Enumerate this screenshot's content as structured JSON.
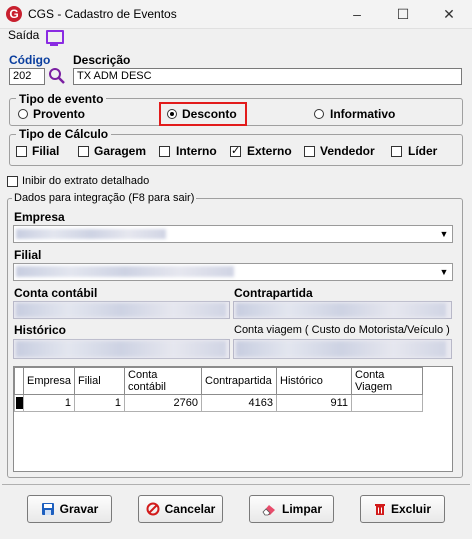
{
  "window": {
    "title": "CGS - Cadastro de Eventos",
    "minimize": "–",
    "maximize": "☐",
    "close": "✕"
  },
  "menu": {
    "saida": "Saída"
  },
  "codigo": {
    "label": "Código",
    "value": "202"
  },
  "descricao": {
    "label": "Descrição",
    "value": "TX ADM DESC"
  },
  "tipo_evento": {
    "title": "Tipo de evento",
    "options": [
      {
        "label": "Provento",
        "selected": false
      },
      {
        "label": "Desconto",
        "selected": true
      },
      {
        "label": "Informativo",
        "selected": false
      }
    ]
  },
  "tipo_calculo": {
    "title": "Tipo de Cálculo",
    "options": [
      {
        "label": "Filial",
        "checked": false
      },
      {
        "label": "Garagem",
        "checked": false
      },
      {
        "label": "Interno",
        "checked": false
      },
      {
        "label": "Externo",
        "checked": true
      },
      {
        "label": "Vendedor",
        "checked": false
      },
      {
        "label": "Líder",
        "checked": false
      }
    ]
  },
  "inibir": {
    "label": "Inibir do extrato detalhado",
    "checked": false
  },
  "integracao": {
    "title": "Dados para integração  (F8 para sair)",
    "empresa_label": "Empresa",
    "filial_label": "Filial",
    "conta_contabil_label": "Conta contábil",
    "contrapartida_label": "Contrapartida",
    "historico_label": "Histórico",
    "conta_viagem_label": "Conta viagem ( Custo do Motorista/Veículo )"
  },
  "grid": {
    "columns": [
      "Empresa",
      "Filial",
      "Conta contábil",
      "Contrapartida",
      "Histórico",
      "Conta Viagem"
    ],
    "rows": [
      [
        "1",
        "1",
        "2760",
        "4163",
        "911",
        ""
      ]
    ]
  },
  "buttons": {
    "gravar": "Gravar",
    "cancelar": "Cancelar",
    "limpar": "Limpar",
    "excluir": "Excluir"
  },
  "colors": {
    "accent_red": "#e21b1b",
    "label_blue": "#0a3e9e",
    "monitor_purple": "#8a2be2"
  }
}
